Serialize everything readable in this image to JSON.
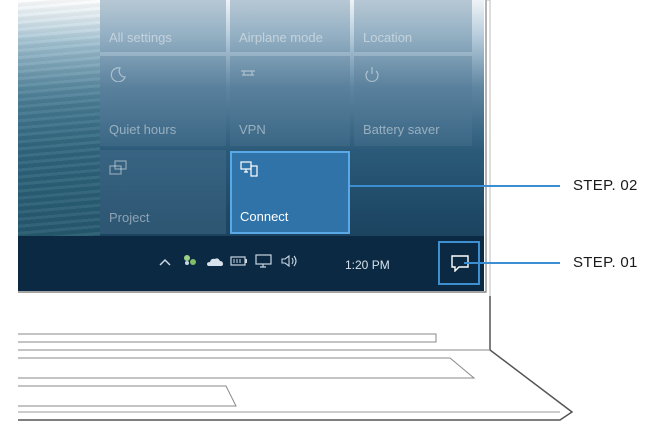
{
  "quick_actions": {
    "row1": [
      "All settings",
      "Airplane mode",
      "Location"
    ],
    "row2": [
      "Quiet hours",
      "VPN",
      "Battery saver"
    ],
    "row3": [
      "Project",
      "Connect"
    ]
  },
  "taskbar": {
    "time": "1:20 PM"
  },
  "callouts": {
    "step2": "STEP. 02",
    "step1": "STEP. 01"
  },
  "colors": {
    "accent": "#3b8ed1",
    "taskbar": "#0b2942",
    "active_tile": "#2f73a8"
  },
  "icons": [
    "moon-icon",
    "vpn-icon",
    "battery-saver-icon",
    "project-icon",
    "connect-icon",
    "chevron-up-icon",
    "network-icon",
    "onedrive-icon",
    "battery-icon",
    "display-icon",
    "volume-icon",
    "action-center-icon"
  ]
}
